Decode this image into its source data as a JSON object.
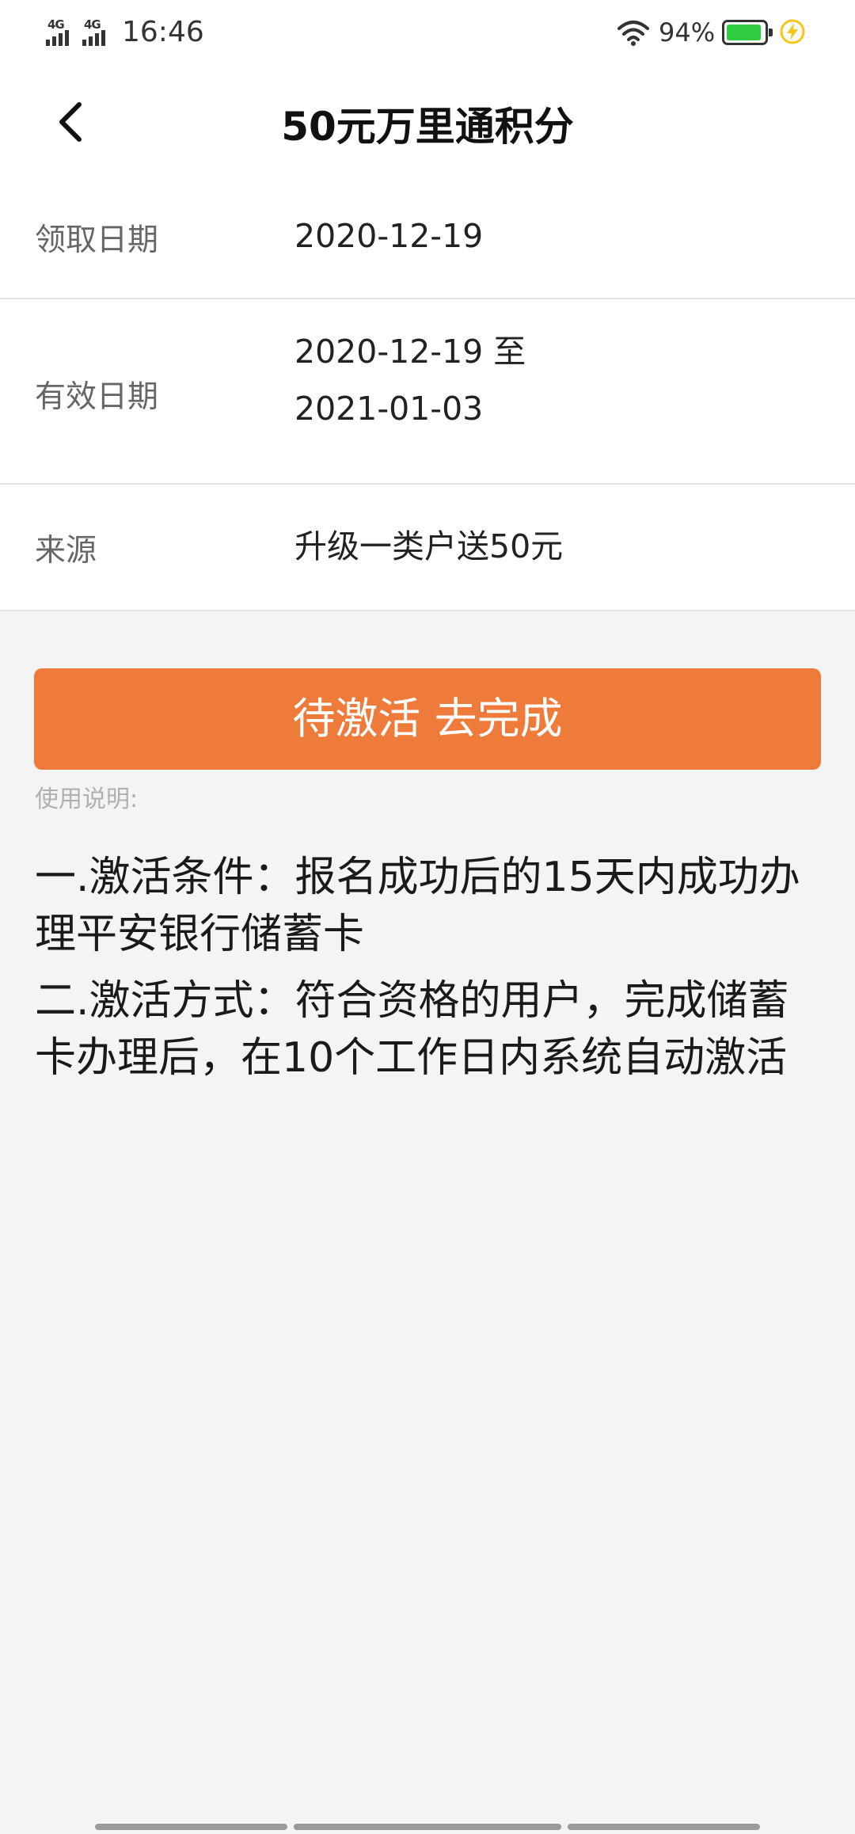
{
  "status_bar": {
    "network1": "4G",
    "network2": "4G",
    "time": "16:46",
    "battery_percent": "94%",
    "battery_level": 0.94,
    "battery_color": "#2ecc40",
    "charging_color": "#f5c518",
    "icons": [
      "signal-icon",
      "wifi-icon",
      "battery-icon",
      "charging-icon"
    ]
  },
  "header": {
    "title": "50元万里通积分",
    "back_icon": "chevron-left-icon"
  },
  "details": {
    "claim_date": {
      "label": "领取日期",
      "value": "2020-12-19"
    },
    "valid_period": {
      "label": "有效日期",
      "value_line1": "2020-12-19 至",
      "value_line2": "2021-01-03"
    },
    "source": {
      "label": "来源",
      "value": "升级一类户送50元"
    }
  },
  "action": {
    "label": "待激活 去完成",
    "color": "#ef7b3b"
  },
  "usage": {
    "label": "使用说明:",
    "items": [
      "一.激活条件：报名成功后的15天内成功办理平安银行储蓄卡",
      "二.激活方式：符合资格的用户，完成储蓄卡办理后，在10个工作日内系统自动激活"
    ]
  }
}
